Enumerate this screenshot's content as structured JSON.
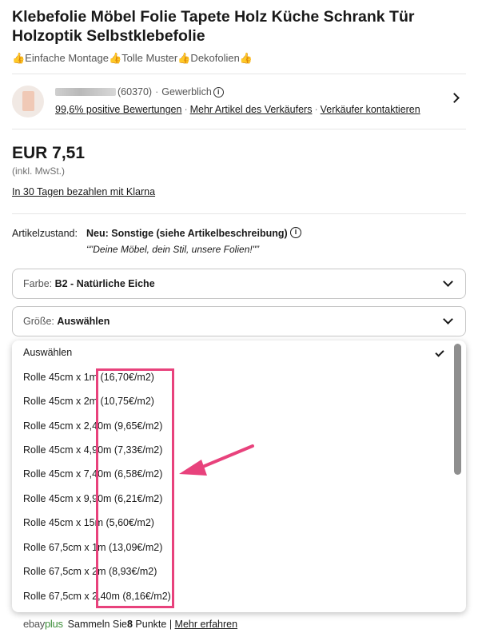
{
  "product": {
    "title": "Klebefolie Möbel Folie Tapete Holz Küche Schrank Tür Holzoptik Selbstklebefolie",
    "subtitle": "👍Einfache Montage👍Tolle Muster👍Dekofolien👍"
  },
  "seller": {
    "rating_count": "(60370)",
    "separator": "·",
    "type": "Gewerblich",
    "positive": "99,6% positive Bewertungen",
    "more_items": "Mehr Artikel des Verkäufers",
    "contact": "Verkäufer kontaktieren"
  },
  "pricing": {
    "price": "EUR 7,51",
    "vat": "(inkl. MwSt.)",
    "klarna": "In 30 Tagen bezahlen mit Klarna"
  },
  "condition": {
    "label": "Artikelzustand:",
    "value": "Neu: Sonstige (siehe Artikelbeschreibung)",
    "quote": "“\"Deine Möbel, dein Stil, unsere Folien!\"”"
  },
  "selects": {
    "color_label": "Farbe: ",
    "color_value": "B2 - Natürliche Eiche",
    "size_label": "Größe: ",
    "size_value": "Auswählen"
  },
  "dropdown": {
    "options": [
      "Auswählen",
      "Rolle 45cm x 1m (16,70€/m2)",
      "Rolle 45cm x 2m (10,75€/m2)",
      "Rolle 45cm x 2,40m (9,65€/m2)",
      "Rolle 45cm x 4,90m (7,33€/m2)",
      "Rolle 45cm x 7,40m (6,58€/m2)",
      "Rolle 45cm x 9,90m (6,21€/m2)",
      "Rolle 45cm x 15m (5,60€/m2)",
      "Rolle 67,5cm x 1m (13,09€/m2)",
      "Rolle 67,5cm x 2m (8,93€/m2)",
      "Rolle 67,5cm x 2,40m (8,16€/m2)"
    ],
    "selected": "Auswählen"
  },
  "ebayplus": {
    "logo_ebay": "ebay",
    "logo_plus": "plus",
    "text_pre": "Sammeln Sie ",
    "points": "8",
    "text_post": " Punkte | ",
    "more": "Mehr erfahren"
  },
  "colors": {
    "highlight": "#e8427c",
    "text": "#191919"
  }
}
